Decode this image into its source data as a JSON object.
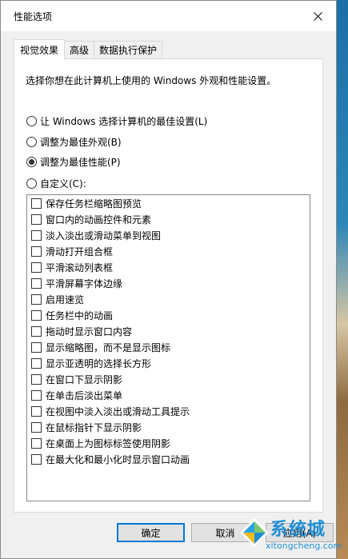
{
  "window": {
    "title": "性能选项"
  },
  "tabs": [
    {
      "label": "视觉效果",
      "active": true
    },
    {
      "label": "高级",
      "active": false
    },
    {
      "label": "数据执行保护",
      "active": false
    }
  ],
  "description": "选择你想在此计算机上使用的 Windows 外观和性能设置。",
  "radios": [
    {
      "label": "让 Windows 选择计算机的最佳设置(L)",
      "checked": false
    },
    {
      "label": "调整为最佳外观(B)",
      "checked": false
    },
    {
      "label": "调整为最佳性能(P)",
      "checked": true
    },
    {
      "label": "自定义(C):",
      "checked": false
    }
  ],
  "options": [
    "保存任务栏缩略图预览",
    "窗口内的动画控件和元素",
    "淡入淡出或滑动菜单到视图",
    "滑动打开组合框",
    "平滑滚动列表框",
    "平滑屏幕字体边缘",
    "启用速览",
    "任务栏中的动画",
    "拖动时显示窗口内容",
    "显示缩略图，而不是显示图标",
    "显示亚透明的选择长方形",
    "在窗口下显示阴影",
    "在单击后淡出菜单",
    "在视图中淡入淡出或滑动工具提示",
    "在鼠标指针下显示阴影",
    "在桌面上为图标标签使用阴影",
    "在最大化和最小化时显示窗口动画"
  ],
  "buttons": {
    "ok": "确定",
    "cancel": "取消",
    "apply": "应用(A)"
  },
  "watermark": {
    "brand": "系统城",
    "url": "xitongcheng.com"
  },
  "colors": {
    "accent": "#0078d7",
    "watermark": "#1f8fd6"
  }
}
